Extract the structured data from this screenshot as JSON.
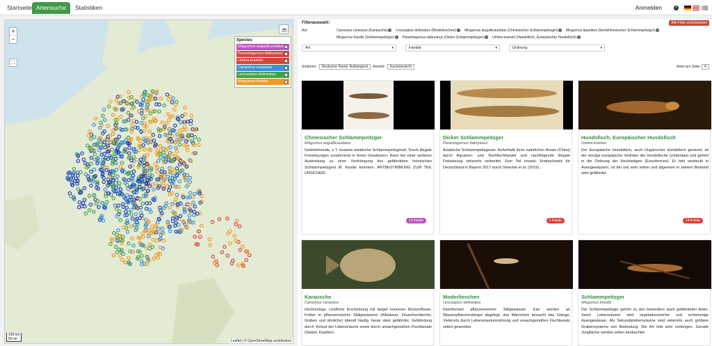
{
  "nav": {
    "items": [
      {
        "label": "Startseite",
        "active": false
      },
      {
        "label": "Artensuche",
        "active": true
      },
      {
        "label": "Statistiken",
        "active": false
      }
    ],
    "login": "Anmelden",
    "info": "i"
  },
  "map": {
    "legend": {
      "title": "Species",
      "items": [
        {
          "label": "Misgurnus anguillicaudatus",
          "color": "#c052b8"
        },
        {
          "label": "Paramisgurnus dabryanus",
          "color": "#d9433a"
        },
        {
          "label": "Umbra krameri",
          "color": "#d9433a"
        },
        {
          "label": "Carassius carassius",
          "color": "#3c8fd2"
        },
        {
          "label": "Leucaspius delineatus",
          "color": "#43a14a"
        },
        {
          "label": "Misgurnus fossilis",
          "color": "#ee9a2a"
        }
      ]
    },
    "zoom_in": "+",
    "zoom_out": "−",
    "scale_top": "100 km",
    "scale_bottom": "50 mi",
    "attribution": "Leaflet | © OpenStreetMap contributors"
  },
  "filter": {
    "title": "Filterauswahl:",
    "reset": "Alle Filter zurücksetzen",
    "art_label": "Art:",
    "chips": [
      "Carassius carassius (Karausche)",
      "Leucaspius delineatus (Moderlieschen)",
      "Misgurnus anguillicaudatus (Chinesischer Schlammpeitzger)",
      "Misgurnus bipartitus (Nordchinesischer Schlammpeitzger)",
      "Misgurnus fossilis (Schlammpeitzger)",
      "Paramisgurnus dabryanus (Dicker Schlammpeitzger)",
      "Umbra krameri (Hundsfisch, Europäischer Hundsfisch)"
    ],
    "selects": [
      "Art",
      "Familie",
      "Ordnung"
    ]
  },
  "sort": {
    "label": "Sortieren:",
    "value": "Deutscher Name: Aufsteigend",
    "view_label": "Ansicht:",
    "view_value": "Kachelansicht",
    "per_page_label": "Arten pro Seite:",
    "per_page_value": "6"
  },
  "cards": [
    {
      "title": "Chinesischer Schlammpeitzger",
      "sub": "Misgurnus anguillicaudatus",
      "desc": "Gebietsfremde, z.T. invasive asiatische Schlammpeitzgerart. Durch illegale Freisetzungen zunehmend in freien Gewässern. Kann bei einer weiteren Ausbreitung zu einer Verdrängung des gefährdeten heimischen Schlammpeitzgers M. fossilis kommen. ARTBESTIMMUNG ZUM TEIL UNSICHER!",
      "badge": "13 Funde",
      "badge_color": "#c052b8"
    },
    {
      "title": "Dicker Schlammpeitzger",
      "sub": "Paramisgurnus dabryanus",
      "desc": "Asiatische Schlammpeitzgerart. Außerhalb ihres natürlichen Areals (China) durch Aquarien- und Teichfischhandel und nachfolgende illegale Freisetzung vielerorts verbreitet. Zum Teil invasiv. Erstnachweis für Deutschland in Bayern 2017 durch Stoeckle et al. (2019).",
      "badge": "2 Funde",
      "badge_color": "#d9433a"
    },
    {
      "title": "Hundsfisch, Europäischer Hundsfisch",
      "sub": "Umbra krameri",
      "desc": "Der Europäische Hundsfisch, auch Ungarischer Hundsfisch genannt, ist der einzige europäische Vertreter der Hundsfische (Umbridae) und gehört in die Ordnung der Hechtartigen (Esociformes). Er lebt versteckt in Auengewässern, ist bei uns sehr selten und allgemein in seinem Bestand sehr gefährdet.",
      "badge": "14 Funde",
      "badge_color": "#d9433a"
    },
    {
      "title": "Karausche",
      "sub": "Carassius carassius",
      "desc": "Hochrückige, rundliche Erscheinung mit langer konvexer Rückenflosse. Früher in pflanzenreichen Stillgewässern (Altwässer, Feuerlöschteiche, Gräben und ähnliche) überall häufig, heute stark gefährdet. Gefährdung durch Verlust der Lebensräume sowie durch unsachgemäßen Fischbesatz (Giebel, Karpfen).",
      "badge": "",
      "badge_color": "#3c8fd2"
    },
    {
      "title": "Moderlieschen",
      "sub": "Leucaspius delineatus",
      "desc": "Kleinfischart pflanzenreicher Stillgewässer. Eier werden an Wasserpflanzenstängel abgelegt, das Männchen bewacht das Gelege. Vielerorts durch Lebensraumzerstörung und unsachgemäßen Fischbesatz selten geworden.",
      "badge": "",
      "badge_color": "#43a14a"
    },
    {
      "title": "Schlammpeitzger",
      "sub": "Misgurnus fossilis",
      "desc": "Der Schlammpeitzger gehört zu den besonders stark gefährdeten Arten. Seine Lebensräume sind vegetationsreiche und schlammige Auengewässer. Als Sekundärlebensräume sind vielerorts auch größere Grabensysteme von Bedeutung. Die Art lebt sehr verborgen. Gerade Jungfische werden selten beobachtet.",
      "badge": "",
      "badge_color": "#ee9a2a"
    }
  ]
}
